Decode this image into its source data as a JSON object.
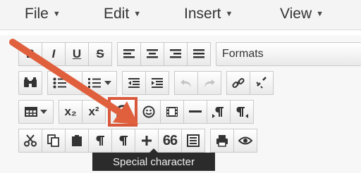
{
  "menubar": {
    "items": [
      {
        "label": "File",
        "caret": "▼"
      },
      {
        "label": "Edit",
        "caret": "▼"
      },
      {
        "label": "Insert",
        "caret": "▼"
      },
      {
        "label": "View",
        "caret": "▼"
      }
    ]
  },
  "toolbar": {
    "row1": {
      "bold": "B",
      "italic": "I",
      "underline": "U",
      "strikethrough": "S",
      "formats_label": "Formats"
    },
    "row3": {
      "subscript": "x₂",
      "superscript": "x²",
      "special_char": "Ω"
    },
    "row4": {
      "blockquote": "66"
    }
  },
  "tooltip": {
    "text": "Special character"
  },
  "colors": {
    "highlight": "#d9573a",
    "arrow": "#e0603e",
    "tooltip_bg": "#2b2b2b"
  }
}
